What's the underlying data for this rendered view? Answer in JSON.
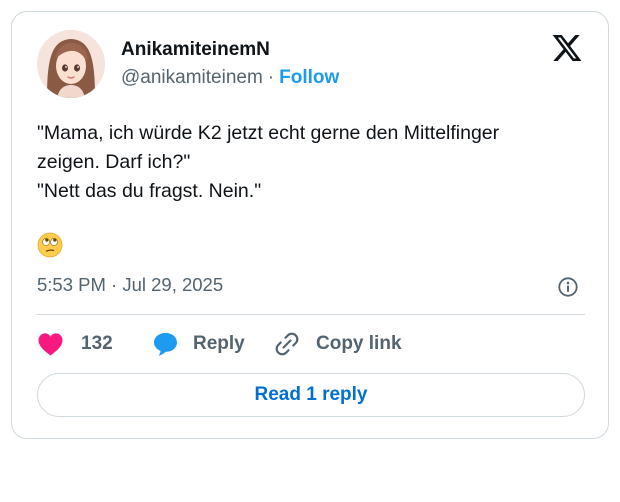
{
  "author": {
    "display_name": "AnikamiteinemN",
    "handle": "@anikamiteinem",
    "separator": "·",
    "follow_label": "Follow",
    "avatar_icon": "anime-girl-avatar"
  },
  "brand": {
    "logo_icon": "x-logo-icon"
  },
  "tweet": {
    "lines": [
      "\"Mama, ich würde K2 jetzt echt gerne den Mittelfinger",
      "zeigen. Darf ich?\"",
      "\"Nett das du fragst. Nein.\""
    ],
    "emoji": "🙄",
    "timestamp": "5:53 PM · Jul 29, 2025"
  },
  "actions": {
    "like_count": "132",
    "reply_label": "Reply",
    "copy_link_label": "Copy link",
    "read_reply_label": "Read 1 reply"
  },
  "colors": {
    "like": "#f91880",
    "reply": "#1d9bf0",
    "follow": "#1d9bf0",
    "read_reply": "#006fd6",
    "muted": "#536471",
    "border": "#cfd9de"
  }
}
